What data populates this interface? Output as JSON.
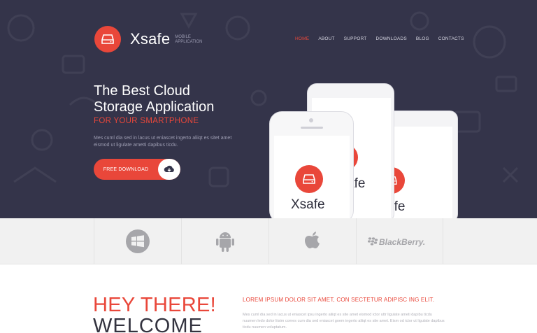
{
  "brand": {
    "name": "Xsafe",
    "tagline": "MOBILE APPLICATION"
  },
  "nav": {
    "items": [
      "HOME",
      "ABOUT",
      "SUPPORT",
      "DOWNLOADS",
      "BLOG",
      "CONTACTS"
    ],
    "active": "HOME"
  },
  "hero": {
    "title_line1": "The Best Cloud",
    "title_line2": "Storage Application",
    "subtitle": "FOR YOUR SMARTPHONE",
    "description": "Mes cuml dia sed in lacus ut eniascet ingerto aliiqt es sitet amet eismod ut ligulate ametti dapibus ticdu.",
    "download_label": "FREE DOWNLOAD",
    "download_icon": "cloud-download-icon"
  },
  "phones": {
    "front_app_name": "Xsafe",
    "back_app_name_1": "afe",
    "back_app_name_2": "afe"
  },
  "platforms": [
    {
      "name": "windows",
      "icon": "windows-icon"
    },
    {
      "name": "android",
      "icon": "android-icon"
    },
    {
      "name": "apple",
      "icon": "apple-icon"
    },
    {
      "name": "blackberry",
      "icon": "blackberry-icon",
      "label": "BlackBerry."
    }
  ],
  "welcome": {
    "line1": "HEY THERE!",
    "line2": "WELCOME",
    "heading": "LOREM IPSUM DOLOR SIT AMET, CON SECTETUR ADIPISC ING ELIT.",
    "body": "Mes cuml dia sed in lacus ut eniascet ipsu ingerto aliiqt es site amet eismod ictor uttr ligulate ameti dapibu ticdu nuumen ledo dolor liisim comes cum dia sed eniascet goem ingerto aliiqt es site amet. Eism od ictor ut ligulate dapibus ticdu nuumen voluptatum."
  },
  "colors": {
    "accent": "#e9473a",
    "hero_bg": "#34344a",
    "platform_bg": "#f1f1f1"
  }
}
